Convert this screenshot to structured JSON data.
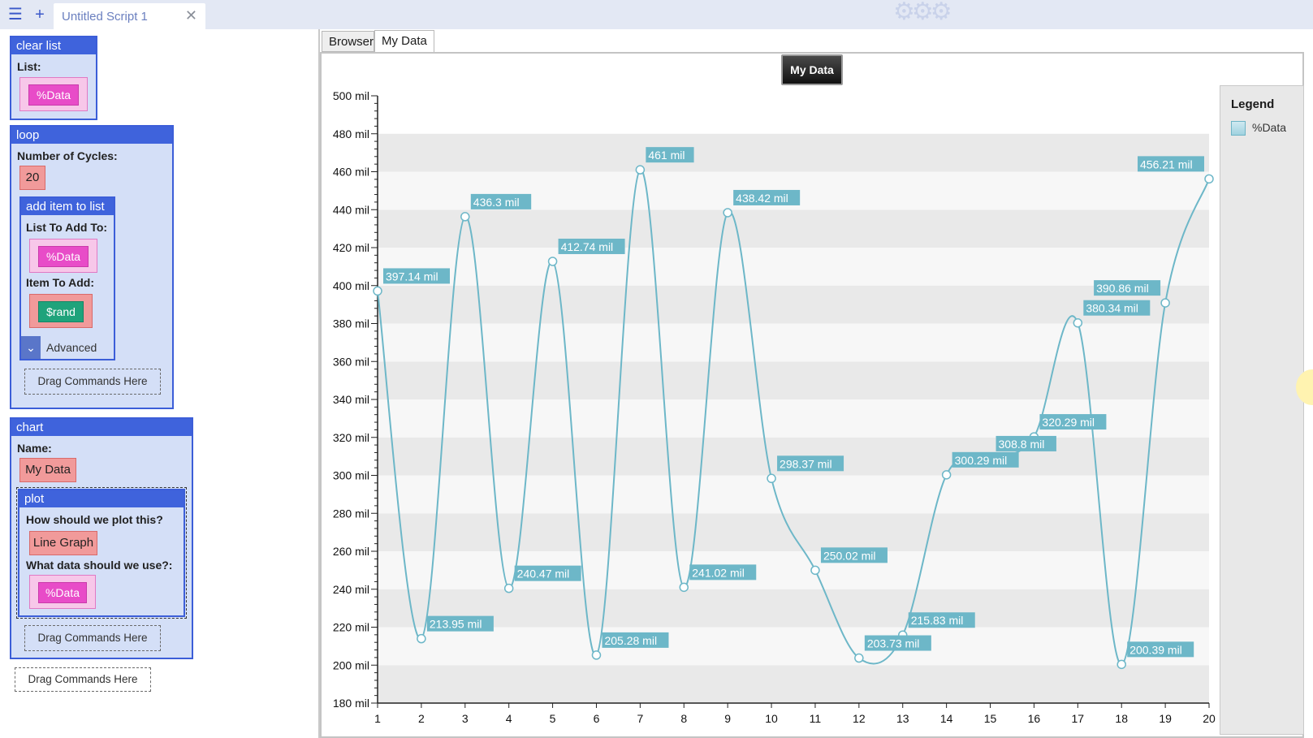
{
  "topbar": {
    "menu_icon": "hamburger-menu-icon",
    "add_icon": "plus-icon",
    "tab_title": "Untitled Script 1",
    "close_icon": "close-icon"
  },
  "left": {
    "clear_list": {
      "header": "clear list",
      "list_label": "List:",
      "list_value": "%Data"
    },
    "loop": {
      "header": "loop",
      "cycles_label": "Number of Cycles:",
      "cycles_value": "20",
      "add_item": {
        "header": "add item to list",
        "list_label": "List To Add To:",
        "list_value": "%Data",
        "item_label": "Item To Add:",
        "item_value": "$rand",
        "advanced": "Advanced"
      },
      "drag": "Drag Commands Here"
    },
    "chart": {
      "header": "chart",
      "name_label": "Name:",
      "name_value": "My Data",
      "plot": {
        "header": "plot",
        "how_label": "How should we plot this?",
        "how_value": "Line Graph",
        "data_label": "What data should we use?:",
        "data_value": "%Data"
      },
      "drag": "Drag Commands Here"
    },
    "drag_bottom": "Drag Commands Here"
  },
  "right": {
    "tabs": [
      "Browser",
      "My Data"
    ],
    "title_button": "My Data",
    "legend_title": "Legend",
    "legend_item": "%Data"
  },
  "chart_data": {
    "type": "line",
    "title": "My Data",
    "x": [
      1,
      2,
      3,
      4,
      5,
      6,
      7,
      8,
      9,
      10,
      11,
      12,
      13,
      14,
      15,
      16,
      17,
      18,
      19,
      20
    ],
    "x_ticks": [
      1,
      2,
      3,
      4,
      5,
      6,
      7,
      8,
      9,
      10,
      11,
      12,
      13,
      14,
      15,
      16,
      17,
      18,
      19,
      20
    ],
    "y_ticks": [
      "180 mil",
      "200 mil",
      "220 mil",
      "240 mil",
      "260 mil",
      "280 mil",
      "300 mil",
      "320 mil",
      "340 mil",
      "360 mil",
      "380 mil",
      "400 mil",
      "420 mil",
      "440 mil",
      "460 mil",
      "480 mil",
      "500 mil"
    ],
    "ylim": [
      180,
      500
    ],
    "y_unit": "mil",
    "series": [
      {
        "name": "%Data",
        "color": "#6db7c8",
        "values": [
          397.14,
          213.95,
          436.3,
          240.47,
          412.74,
          205.28,
          461,
          241.02,
          438.42,
          298.37,
          250.02,
          203.73,
          215.83,
          300.29,
          308.8,
          320.29,
          380.34,
          200.39,
          390.86,
          456.21
        ],
        "labels": [
          "397.14 mil",
          "213.95 mil",
          "436.3 mil",
          "240.47 mil",
          "412.74 mil",
          "205.28 mil",
          "461 mil",
          "241.02 mil",
          "438.42 mil",
          "298.37 mil",
          "250.02 mil",
          "203.73 mil",
          "215.83 mil",
          "300.29 mil",
          "308.8 mil",
          "320.29 mil",
          "380.34 mil",
          "200.39 mil",
          "390.86 mil",
          "456.21 mil"
        ]
      }
    ],
    "grid": true,
    "legend": "right"
  },
  "colors": {
    "accent": "#3f63dc",
    "series": "#6db7c8",
    "band": "#e9e9e9"
  }
}
